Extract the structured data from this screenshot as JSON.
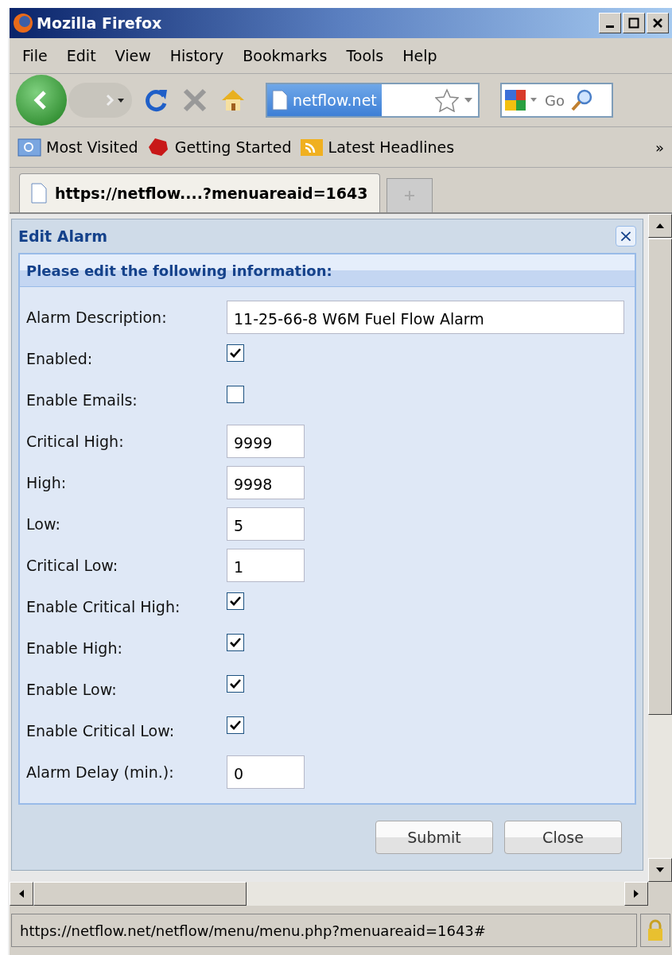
{
  "window": {
    "title": "Mozilla Firefox"
  },
  "menu": [
    "File",
    "Edit",
    "View",
    "History",
    "Bookmarks",
    "Tools",
    "Help"
  ],
  "address": {
    "value": "netflow.net"
  },
  "search": {
    "placeholder": "Go"
  },
  "bookmarks": [
    "Most Visited",
    "Getting Started",
    "Latest Headlines"
  ],
  "bookmarks_overflow": "»",
  "tabs": [
    {
      "label": "https://netflow....?menuareaid=1643",
      "selected": true
    }
  ],
  "dialog": {
    "title": "Edit Alarm",
    "close": "×",
    "section_title": "Please edit the following information:",
    "fields": [
      {
        "kind": "text",
        "label": "Alarm Description:",
        "value": "11-25-66-8 W6M Fuel Flow Alarm"
      },
      {
        "kind": "checkbox",
        "label": "Enabled:",
        "checked": true
      },
      {
        "kind": "checkbox",
        "label": "Enable Emails:",
        "checked": false
      },
      {
        "kind": "number",
        "label": "Critical High:",
        "value": "9999"
      },
      {
        "kind": "number",
        "label": "High:",
        "value": "9998"
      },
      {
        "kind": "number",
        "label": "Low:",
        "value": "5"
      },
      {
        "kind": "number",
        "label": "Critical Low:",
        "value": "1"
      },
      {
        "kind": "checkbox",
        "label": "Enable Critical High:",
        "checked": true
      },
      {
        "kind": "checkbox",
        "label": "Enable High:",
        "checked": true
      },
      {
        "kind": "checkbox",
        "label": "Enable Low:",
        "checked": true
      },
      {
        "kind": "checkbox",
        "label": "Enable Critical Low:",
        "checked": true
      },
      {
        "kind": "number",
        "label": "Alarm Delay (min.):",
        "value": "0"
      }
    ],
    "buttons": [
      "Submit",
      "Close"
    ]
  },
  "status_bar": {
    "text": "https://netflow.net/netflow/menu/menu.php?menuareaid=1643#"
  }
}
